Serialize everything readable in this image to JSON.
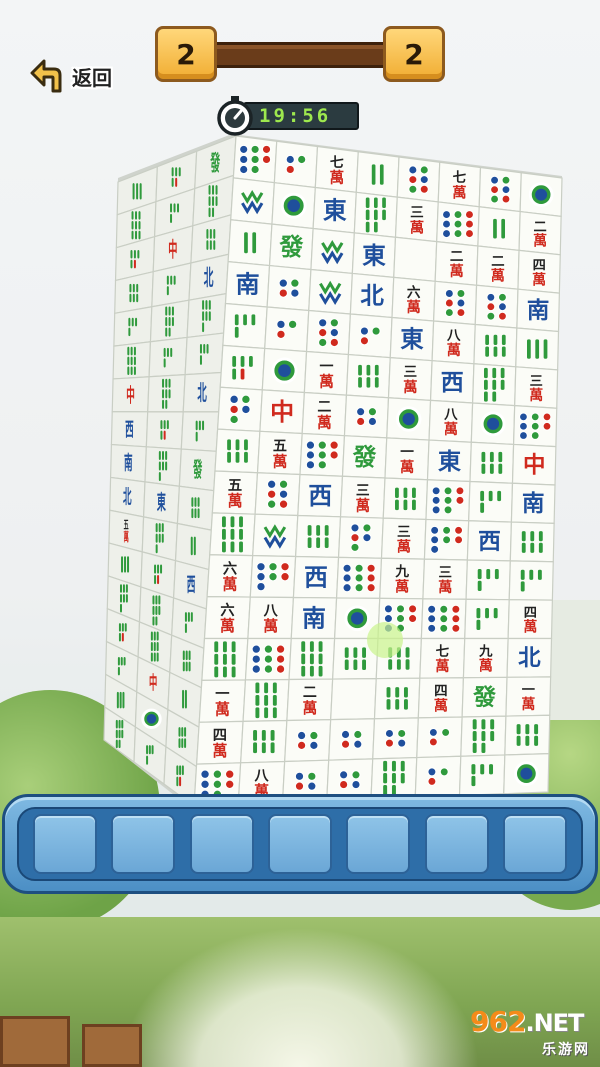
{
  "hud": {
    "back_label": "返回",
    "score_left": "2",
    "score_right": "2",
    "timer": "19:56"
  },
  "tray": {
    "slot_count": 7
  },
  "tower": {
    "front_face": {
      "rows": [
        [
          "8-dot",
          "3-dot",
          "七萬",
          "2-bam",
          "6-dot",
          "七萬",
          "6-dot",
          "1-dot"
        ],
        [
          "green-flower",
          "1-dot",
          "東",
          "8-bam",
          "三萬",
          "9-dot",
          "2-bam",
          "二萬"
        ],
        [
          "2-bam",
          "發",
          "green-flower",
          "東",
          "bird-bam",
          "二萬",
          "二萬",
          "四萬"
        ],
        [
          "南",
          "4-dot",
          "green-flower",
          "北",
          "六萬",
          "6-dot",
          "6-dot",
          "南"
        ],
        [
          "4-bam",
          "3-dot",
          "6-dot",
          "3-dot",
          "東",
          "八萬",
          "6-bam",
          "3-bam"
        ],
        [
          "5-bam",
          "1-dot",
          "一萬",
          "6-bam",
          "三萬",
          "西",
          "8-bam",
          "三萬"
        ],
        [
          "5-dot",
          "中",
          "二萬",
          "4-dot",
          "1-dot",
          "八萬",
          "1-dot",
          "8-dot"
        ],
        [
          "6-bam",
          "五萬",
          "8-dot",
          "發",
          "一萬",
          "東",
          "6-bam",
          "中"
        ],
        [
          "五萬",
          "6-dot",
          "西",
          "三萬",
          "6-bam",
          "8-dot",
          "4-bam",
          "南"
        ],
        [
          "9-bam",
          "green-flower",
          "6-bam",
          "5-dot",
          "三萬",
          "7-dot",
          "西",
          "6-bam"
        ],
        [
          "六萬",
          "7-dot",
          "西",
          "9-dot",
          "九萬",
          "三萬",
          "4-bam",
          "4-bam"
        ],
        [
          "六萬",
          "八萬",
          "南",
          "1-dot",
          "8-dot",
          "9-dot",
          "4-bam",
          "四萬"
        ],
        [
          "9-bam",
          "9-dot",
          "9-bam",
          "6-bam",
          "6-bam",
          "七萬",
          "九萬",
          "北"
        ],
        [
          "一萬",
          "9-bam",
          "二萬",
          "bird-bam",
          "6-bam",
          "四萬",
          "發",
          "一萬"
        ],
        [
          "四萬",
          "6-bam",
          "4-dot",
          "4-dot",
          "4-dot",
          "3-dot",
          "8-bam",
          "6-bam"
        ],
        [
          "8-dot",
          "八萬",
          "4-dot",
          "4-dot",
          "8-bam",
          "3-dot",
          "4-bam",
          "1-dot"
        ]
      ]
    },
    "side_face": {
      "rows": [
        [
          "3-bam",
          "5-bam",
          "發"
        ],
        [
          "9-bam",
          "4-bam",
          "8-bam"
        ],
        [
          "5-bam",
          "中",
          "6-bam"
        ],
        [
          "6-bam",
          "4-bam",
          "北"
        ],
        [
          "4-bam",
          "8-bam",
          "7-bam"
        ],
        [
          "9-bam",
          "4-bam",
          "4-bam"
        ],
        [
          "中",
          "8-bam",
          "北"
        ],
        [
          "西",
          "5-bam",
          "4-bam"
        ],
        [
          "南",
          "7-bam",
          "發"
        ],
        [
          "北",
          "東",
          "6-bam"
        ],
        [
          "五萬",
          "7-bam",
          "2-bam"
        ],
        [
          "3-bam",
          "5-bam",
          "西"
        ],
        [
          "7-bam",
          "8-bam",
          "4-bam"
        ],
        [
          "5-bam",
          "9-bam",
          "6-bam"
        ],
        [
          "4-bam",
          "中",
          "2-bam"
        ],
        [
          "3-bam",
          "1-dot",
          "6-bam"
        ],
        [
          "8-bam",
          "4-bam",
          "5-bam"
        ]
      ]
    }
  },
  "watermark": {
    "main": "962",
    "net": ".NET",
    "sub": "乐游网"
  },
  "colors": {
    "tile_face": "#fbfcf7",
    "tile_edge": "#c9cec4",
    "red": "#d02a1e",
    "green": "#2f9a3c",
    "blue": "#1f4f9c",
    "tray_blue": "#4c8fc5"
  }
}
